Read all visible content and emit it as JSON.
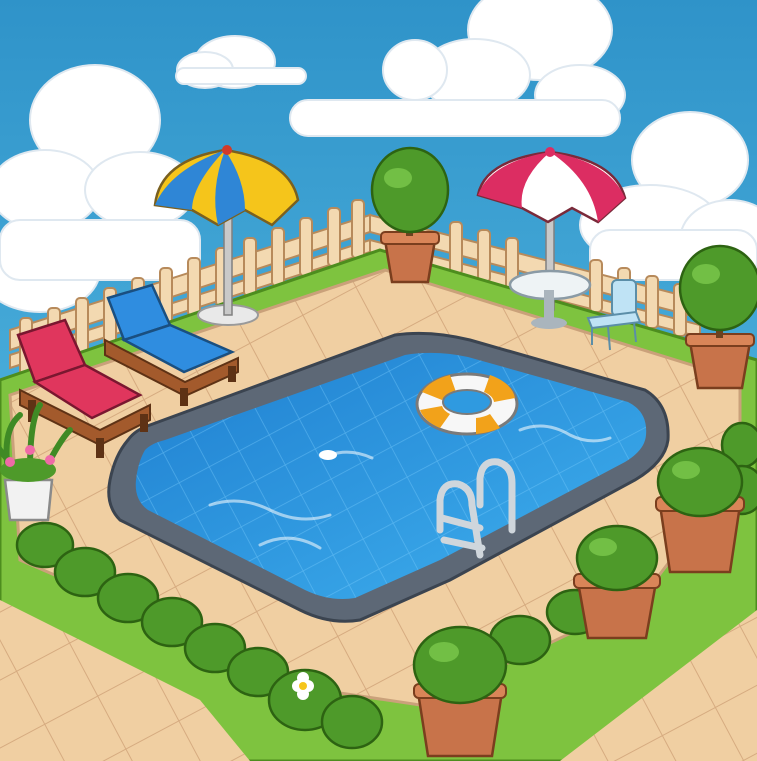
{
  "scene": {
    "type": "isometric-cartoon-game-scene",
    "theme": "backyard-pool",
    "objects": [
      "pool",
      "pool-ladder",
      "swim-ring",
      "beach-umbrella-yellow-blue",
      "beach-umbrella-pink-white",
      "sun-lounger-pink",
      "sun-lounger-blue",
      "round-table",
      "patio-chair",
      "potted-topiary",
      "pink-flower-pot",
      "picket-fence",
      "hedge-border",
      "clouds"
    ]
  },
  "colors": {
    "sky": "#3fa9d6",
    "pool_water": "#2f9ae0",
    "pool_rim": "#5d6876",
    "deck_tile": "#f0cfa2",
    "grass": "#7ec33f",
    "fence": "#f3d9b1",
    "umbrella_yellow": "#f5c51b",
    "umbrella_blue": "#2f86d6",
    "umbrella_pink": "#dc2d62",
    "lounger_pink": "#e0365d",
    "lounger_blue": "#2f8de0",
    "ring_orange": "#f2a21a",
    "pot": "#c8734a",
    "bush": "#4e9a2a"
  }
}
